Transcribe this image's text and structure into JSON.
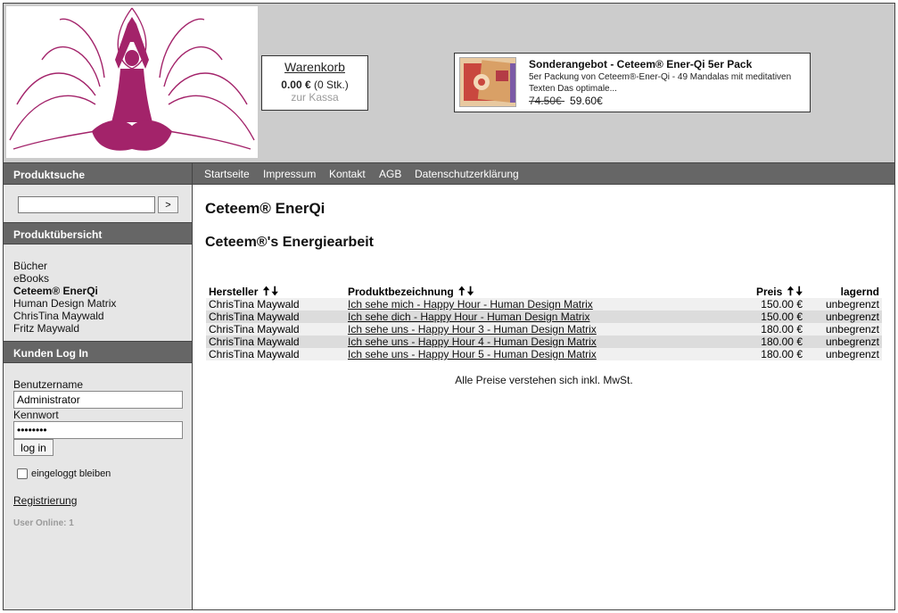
{
  "header": {
    "cart": {
      "title": "Warenkorb",
      "amount": "0.00 €",
      "count": "(0 Stk.)",
      "checkout": "zur Kassa"
    },
    "offer": {
      "title": "Sonderangebot - Ceteem® Ener-Qi 5er Pack",
      "description": "5er Packung von  Ceteem®-Ener-Qi - 49 Mandalas mit meditativen Texten Das optimale...",
      "old_price": " 74.50€ ",
      "new_price": "59.60€"
    },
    "colors": {
      "logo": "#a3236a",
      "header_bg": "#cccccc",
      "bar_bg": "#666666",
      "sidebar_bg": "#e6e6e6"
    }
  },
  "sidebar": {
    "search_heading": "Produktsuche",
    "search_button": ">",
    "search_value": "",
    "catalog_heading": "Produktübersicht",
    "categories": [
      {
        "label": "Bücher",
        "active": false
      },
      {
        "label": "eBooks",
        "active": false
      },
      {
        "label": "Ceteem® EnerQi",
        "active": true
      },
      {
        "label": "Human Design Matrix",
        "active": false
      },
      {
        "label": "ChrisTina Maywald",
        "active": false
      },
      {
        "label": "Fritz Maywald",
        "active": false
      }
    ],
    "login": {
      "heading": "Kunden Log In",
      "username_label": "Benutzername",
      "username_value": "Administrator",
      "password_label": "Kennwort",
      "password_value": "••••••••",
      "button": "log in",
      "remember": "eingeloggt bleiben",
      "register": "Registrierung",
      "online": "User Online: 1"
    }
  },
  "nav": {
    "items": [
      "Startseite",
      "Impressum",
      "Kontakt",
      "AGB",
      "Datenschutzerklärung"
    ]
  },
  "main": {
    "category_title": "Ceteem® EnerQi",
    "subtitle": "Ceteem®'s Energiearbeit",
    "columns": {
      "manufacturer": "Hersteller",
      "product": "Produktbezeichnung",
      "price": "Preis",
      "stock": "lagernd"
    },
    "sort_icons": {
      "up": "🠅",
      "down": "🠇"
    },
    "rows": [
      {
        "manufacturer": "ChrisTina Maywald",
        "product": "Ich sehe mich - Happy Hour - Human Design Matrix",
        "price": "150.00 €",
        "stock": "unbegrenzt"
      },
      {
        "manufacturer": "ChrisTina Maywald",
        "product": "Ich sehe dich - Happy Hour - Human Design Matrix",
        "price": "150.00 €",
        "stock": "unbegrenzt"
      },
      {
        "manufacturer": "ChrisTina Maywald",
        "product": "Ich sehe uns - Happy Hour 3 - Human Design Matrix",
        "price": "180.00 €",
        "stock": "unbegrenzt"
      },
      {
        "manufacturer": "ChrisTina Maywald",
        "product": "Ich sehe uns - Happy Hour 4 - Human Design Matrix",
        "price": "180.00 €",
        "stock": "unbegrenzt"
      },
      {
        "manufacturer": "ChrisTina Maywald",
        "product": "Ich sehe uns - Happy Hour 5 - Human Design Matrix",
        "price": "180.00 €",
        "stock": "unbegrenzt"
      }
    ],
    "vat_note": "Alle Preise verstehen sich inkl. MwSt."
  }
}
